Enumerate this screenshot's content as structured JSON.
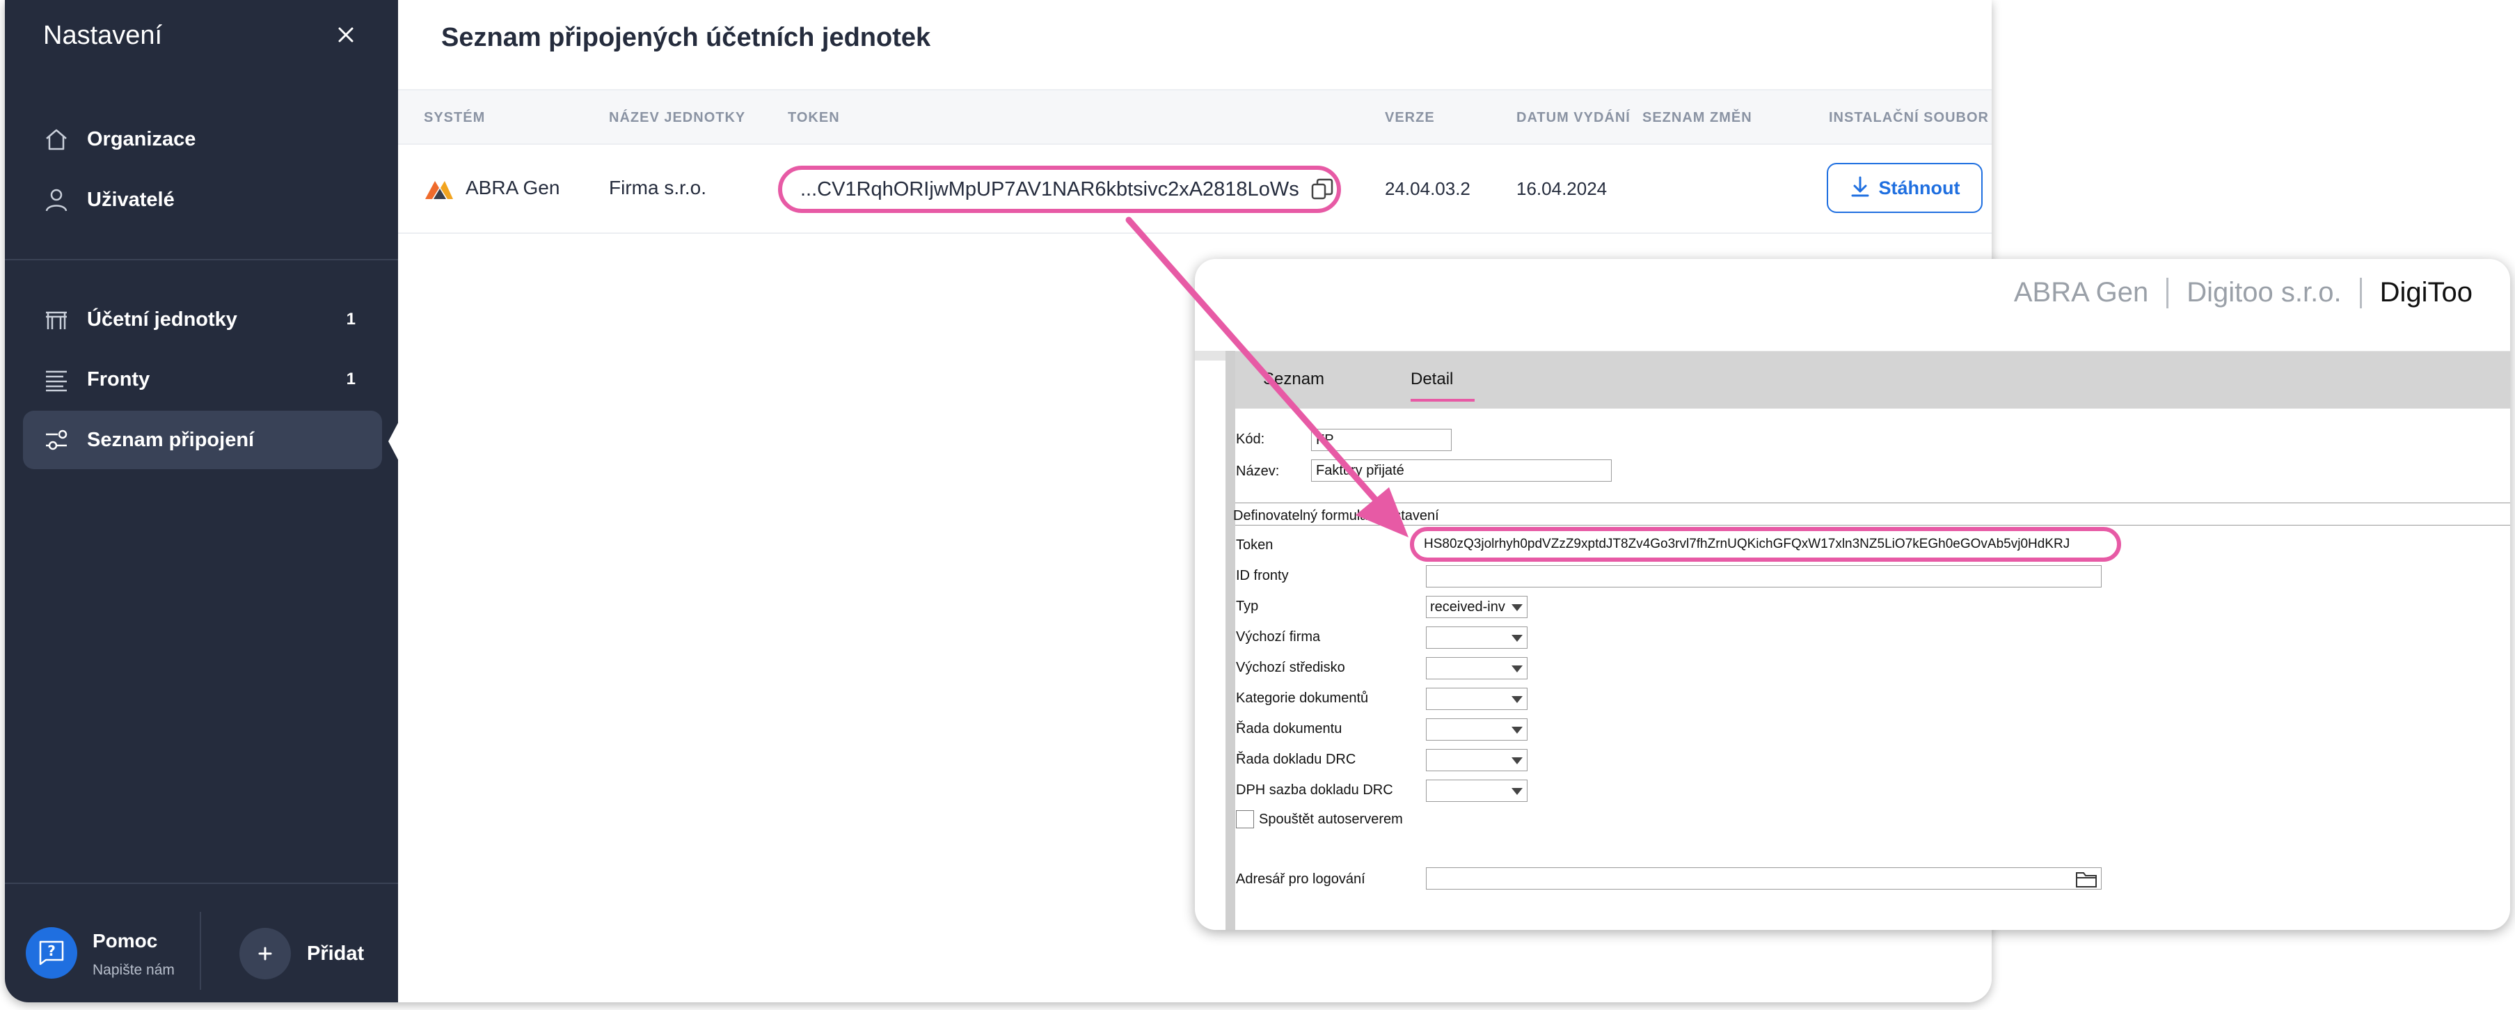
{
  "sidebar": {
    "title": "Nastavení",
    "nav": [
      {
        "label": "Organizace",
        "icon": "home-icon"
      },
      {
        "label": "Uživatelé",
        "icon": "user-icon"
      }
    ],
    "nav2": [
      {
        "label": "Účetní jednotky",
        "count": "1",
        "icon": "building-icon"
      },
      {
        "label": "Fronty",
        "count": "1",
        "icon": "queue-icon"
      },
      {
        "label": "Seznam připojení",
        "icon": "sliders-icon",
        "active": true
      }
    ],
    "help": {
      "title": "Pomoc",
      "subtitle": "Napište nám"
    },
    "add_label": "Přidat"
  },
  "content": {
    "title": "Seznam připojených účetních jednotek",
    "columns": [
      "SYSTÉM",
      "NÁZEV JEDNOTKY",
      "TOKEN",
      "VERZE",
      "DATUM VYDÁNÍ",
      "SEZNAM ZMĚN",
      "INSTALAČNÍ SOUBOR"
    ],
    "row": {
      "system": "ABRA Gen",
      "unit_name": "Firma s.r.o.",
      "token": "...CV1RqhORIjwMpUP7AV1NAR6kbtsivc2xA2818LoWs",
      "version": "24.04.03.2",
      "release_date": "16.04.2024",
      "download_label": "Stáhnout"
    }
  },
  "overlay": {
    "brand": [
      "ABRA Gen",
      "Digitoo s.r.o.",
      "DigiToo"
    ],
    "tabs": [
      "Seznam",
      "Detail"
    ],
    "fields": {
      "kod_label": "Kód:",
      "kod_value": "FP",
      "nazev_label": "Název:",
      "nazev_value": "Faktury přijaté",
      "subtabs": "Definovatelný formulář  Nastavení",
      "token_label": "Token",
      "token_value": "HS80zQ3jolrhyh0pdVZzZ9xptdJT8Zv4Go3rvl7fhZrnUQKichGFQxW17xln3NZ5LiO7kEGh0eGOvAb5vj0HdKRJ",
      "queue_label": "ID fronty",
      "type_label": "Typ",
      "type_value": "received-inv",
      "firm_label": "Výchozí firma",
      "center_label": "Výchozí středisko",
      "category_label": "Kategorie dokumentů",
      "doc_series_label": "Řada dokumentu",
      "drc_series_label": "Řada dokladu DRC",
      "vat_label": "DPH sazba dokladu DRC",
      "autoserver_label": "Spouštět autoserverem",
      "log_dir_label": "Adresář pro logování"
    }
  },
  "colors": {
    "sidebar_bg": "#252c3d",
    "accent_blue": "#1f6fe0",
    "highlight_pink": "#e75aa5"
  }
}
